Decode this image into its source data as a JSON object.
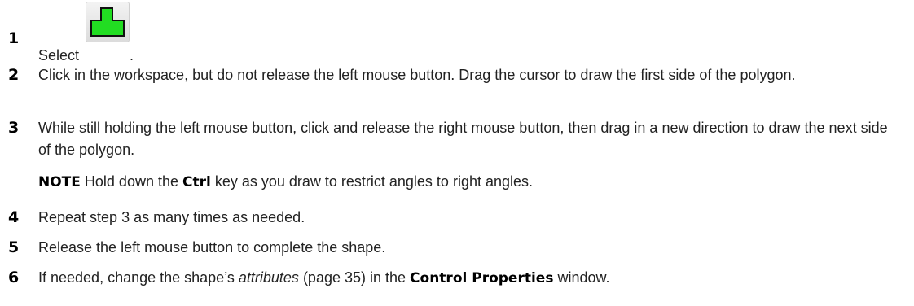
{
  "steps": [
    {
      "number": "1",
      "text_before_icon": "Select",
      "text_after_icon": ".",
      "icon": "polygon-tool-icon",
      "icon_color": "#22dd22"
    },
    {
      "number": "2",
      "text": "Click in the workspace, but do not release the left mouse button. Drag the cursor to draw the first side of the polygon."
    },
    {
      "number": "3",
      "text": "While still holding the left mouse button, click and release the right mouse button, then drag in a new direction to draw the next side of the polygon."
    },
    {
      "number": "4",
      "text": "Repeat step 3 as many times as needed."
    },
    {
      "number": "5",
      "text": "Release the left mouse button to complete the shape."
    },
    {
      "number": "6",
      "text_before_link": "If needed, change the shape’s ",
      "link_text": "attributes",
      "link_page_ref": "(page 35)",
      "text_middle": " in the ",
      "bold_text": "Control Properties",
      "text_after": " window."
    }
  ],
  "note": {
    "label": "NOTE",
    "text_before": "Hold down the ",
    "key": "Ctrl",
    "text_after": " key as you draw to restrict angles to right angles."
  }
}
